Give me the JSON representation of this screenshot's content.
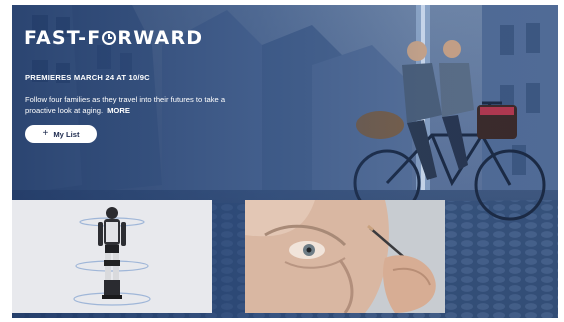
{
  "hero": {
    "logo_part1": "FAST-F",
    "logo_part2": "RWARD",
    "logo_icon": "clock-icon",
    "premiere": "PREMIERES MARCH 24 AT 10/9C",
    "description": "Follow four families as they travel into their futures to take a proactive look at aging.",
    "more_label": "MORE",
    "mylist_label": "My List",
    "mylist_icon": "plus-icon"
  },
  "thumbnails": [
    {
      "name": "exoskeleton-thumbnail"
    },
    {
      "name": "older-woman-makeup-thumbnail"
    }
  ]
}
